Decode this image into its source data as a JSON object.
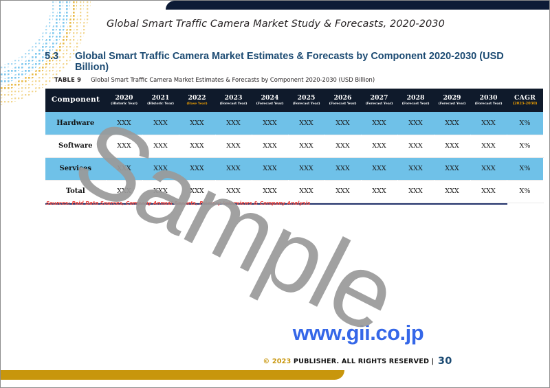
{
  "document": {
    "header_title": "Global Smart Traffic Camera Market Study & Forecasts, 2020-2030",
    "section_number": "5.3",
    "section_title": "Global Smart Traffic Camera Market Estimates & Forecasts by Component 2020-2030 (USD Billion)",
    "table_caption_label": "TABLE 9",
    "table_caption_text": "Global Smart Traffic Camera Market Estimates & Forecasts by Component 2020-2030 (USD Billion)",
    "sources_note": "Sources: Paid Data Sources, Company Annual Reports, Primary Interviews & Company Analysis",
    "watermark": "Sample",
    "website": "www.gii.co.jp",
    "footer_copyright": "© 2023",
    "footer_rights": "PUBLISHER. ALL RIGHTS RESERVED |",
    "page_number": "30"
  },
  "colors": {
    "navy_bar": "#0d1b36",
    "table_header": "#0f1a2b",
    "band_row": "#6fc1e8",
    "heading_blue": "#1b4a72",
    "gold": "#c8960c",
    "accent_gold_text": "#f0a000",
    "source_red": "#e8403a",
    "url_blue": "#3567e8",
    "watermark_gray": "#9a9a9a"
  },
  "table": {
    "columns": [
      {
        "label": "Component",
        "sub": "",
        "type": "component"
      },
      {
        "label": "2020",
        "sub": "(Historic Year)",
        "type": "year"
      },
      {
        "label": "2021",
        "sub": "(Historic Year)",
        "type": "year"
      },
      {
        "label": "2022",
        "sub": "(Base Year)",
        "type": "year-base"
      },
      {
        "label": "2023",
        "sub": "(Forecast Year)",
        "type": "year"
      },
      {
        "label": "2024",
        "sub": "(Forecast Year)",
        "type": "year"
      },
      {
        "label": "2025",
        "sub": "(Forecast Year)",
        "type": "year"
      },
      {
        "label": "2026",
        "sub": "(Forecast Year)",
        "type": "year"
      },
      {
        "label": "2027",
        "sub": "(Forecast Year)",
        "type": "year"
      },
      {
        "label": "2028",
        "sub": "(Forecast Year)",
        "type": "year"
      },
      {
        "label": "2029",
        "sub": "(Forecast Year)",
        "type": "year"
      },
      {
        "label": "2030",
        "sub": "(Forecast Year)",
        "type": "year"
      },
      {
        "label": "CAGR",
        "sub": "(2023-2030)",
        "type": "cagr"
      }
    ],
    "rows": [
      {
        "label": "Hardware",
        "banded": true,
        "values": [
          "XXX",
          "XXX",
          "XXX",
          "XXX",
          "XXX",
          "XXX",
          "XXX",
          "XXX",
          "XXX",
          "XXX",
          "XXX"
        ],
        "cagr": "X%"
      },
      {
        "label": "Software",
        "banded": false,
        "values": [
          "XXX",
          "XXX",
          "XXX",
          "XXX",
          "XXX",
          "XXX",
          "XXX",
          "XXX",
          "XXX",
          "XXX",
          "XXX"
        ],
        "cagr": "X%"
      },
      {
        "label": "Services",
        "banded": true,
        "values": [
          "XXX",
          "XXX",
          "XXX",
          "XXX",
          "XXX",
          "XXX",
          "XXX",
          "XXX",
          "XXX",
          "XXX",
          "XXX"
        ],
        "cagr": "X%"
      },
      {
        "label": "Total",
        "banded": false,
        "values": [
          "XXX",
          "XXX",
          "XXX",
          "XXX",
          "XXX",
          "XXX",
          "XXX",
          "XXX",
          "XXX",
          "XXX",
          "XXX"
        ],
        "cagr": "X%"
      }
    ]
  }
}
